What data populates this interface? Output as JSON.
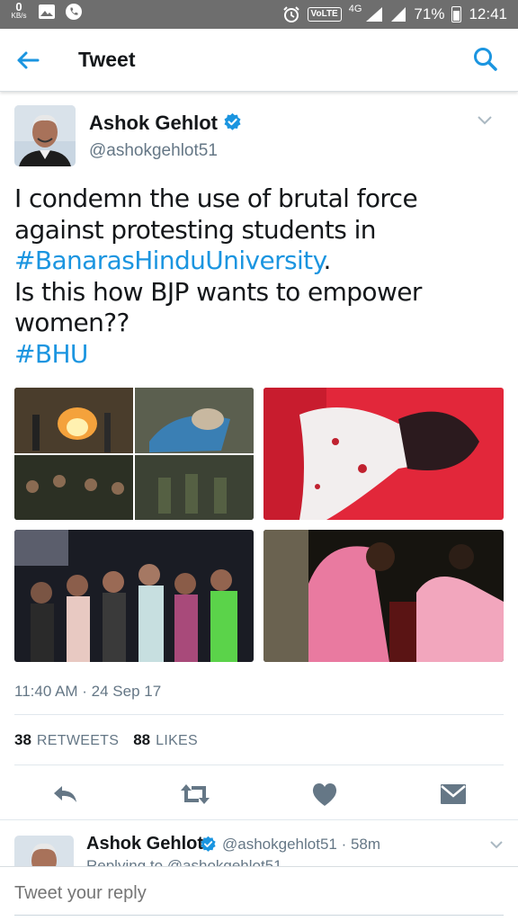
{
  "status_bar": {
    "net_speed": "0",
    "net_unit": "KB/s",
    "volte": "VoLTE",
    "network": "4G",
    "battery": "71%",
    "time": "12:41"
  },
  "app_bar": {
    "title": "Tweet",
    "back_icon": "back-arrow-icon",
    "search_icon": "search-icon"
  },
  "tweet": {
    "author_name": "Ashok Gehlot",
    "author_handle": "@ashokgehlot51",
    "text_lines": [
      {
        "text": "I condemn the use of brutal force"
      },
      {
        "text": "against protesting students in"
      },
      {
        "hashtag": "#BanarasHinduUniversity",
        "suffix": "."
      },
      {
        "text": "Is this how BJP wants to empower"
      },
      {
        "text": "women??"
      },
      {
        "hashtag": "#BHU"
      }
    ],
    "timestamp": "11:40 AM · 24 Sep 17",
    "retweets_count": "38",
    "retweets_label": "RETWEETS",
    "likes_count": "88",
    "likes_label": "LIKES"
  },
  "actions": [
    "reply-icon",
    "retweet-icon",
    "heart-icon",
    "direct-message-icon"
  ],
  "reply_preview": {
    "author_name": "Ashok Gehlot",
    "author_handle": "@ashokgehlot51",
    "age": "· 58m",
    "replying_to": "Replying to @ashokgehlot51"
  },
  "reply_bar": {
    "placeholder": "Tweet your reply"
  },
  "colors": {
    "accent": "#1b95e0",
    "status_bar": "#6e6e6e",
    "secondary_text": "#657786"
  }
}
